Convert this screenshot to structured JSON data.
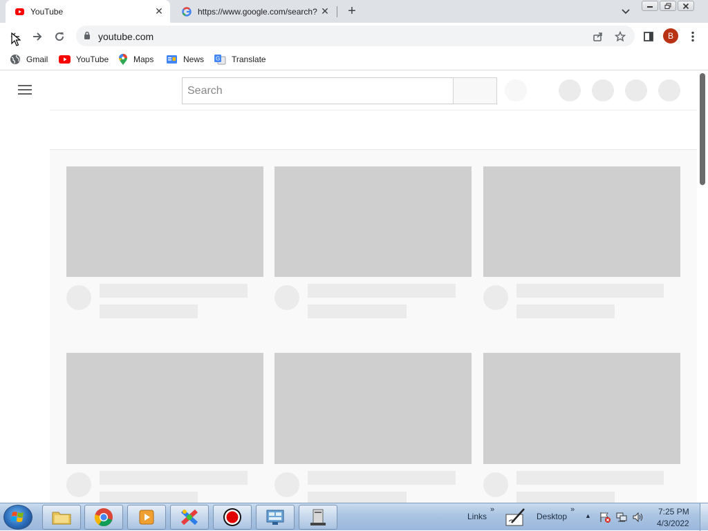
{
  "browser": {
    "tabs": [
      {
        "title": "YouTube",
        "active": true
      },
      {
        "title": "https://www.google.com/search?",
        "active": false
      }
    ],
    "new_tab_symbol": "+",
    "address": "youtube.com",
    "profile_initial": "B",
    "bookmarks": [
      "Gmail",
      "YouTube",
      "Maps",
      "News",
      "Translate"
    ]
  },
  "page": {
    "search_placeholder": "Search",
    "loading_placeholder": true
  },
  "taskbar": {
    "toolbars": [
      "Links",
      "Desktop"
    ],
    "time": "7:25 PM",
    "date": "4/3/2022"
  },
  "colors": {
    "youtube_red": "#ff0000",
    "profile_bg": "#b83213",
    "tab_strip": "#dee1e6",
    "skeleton_thumb": "#cfcfcf"
  }
}
